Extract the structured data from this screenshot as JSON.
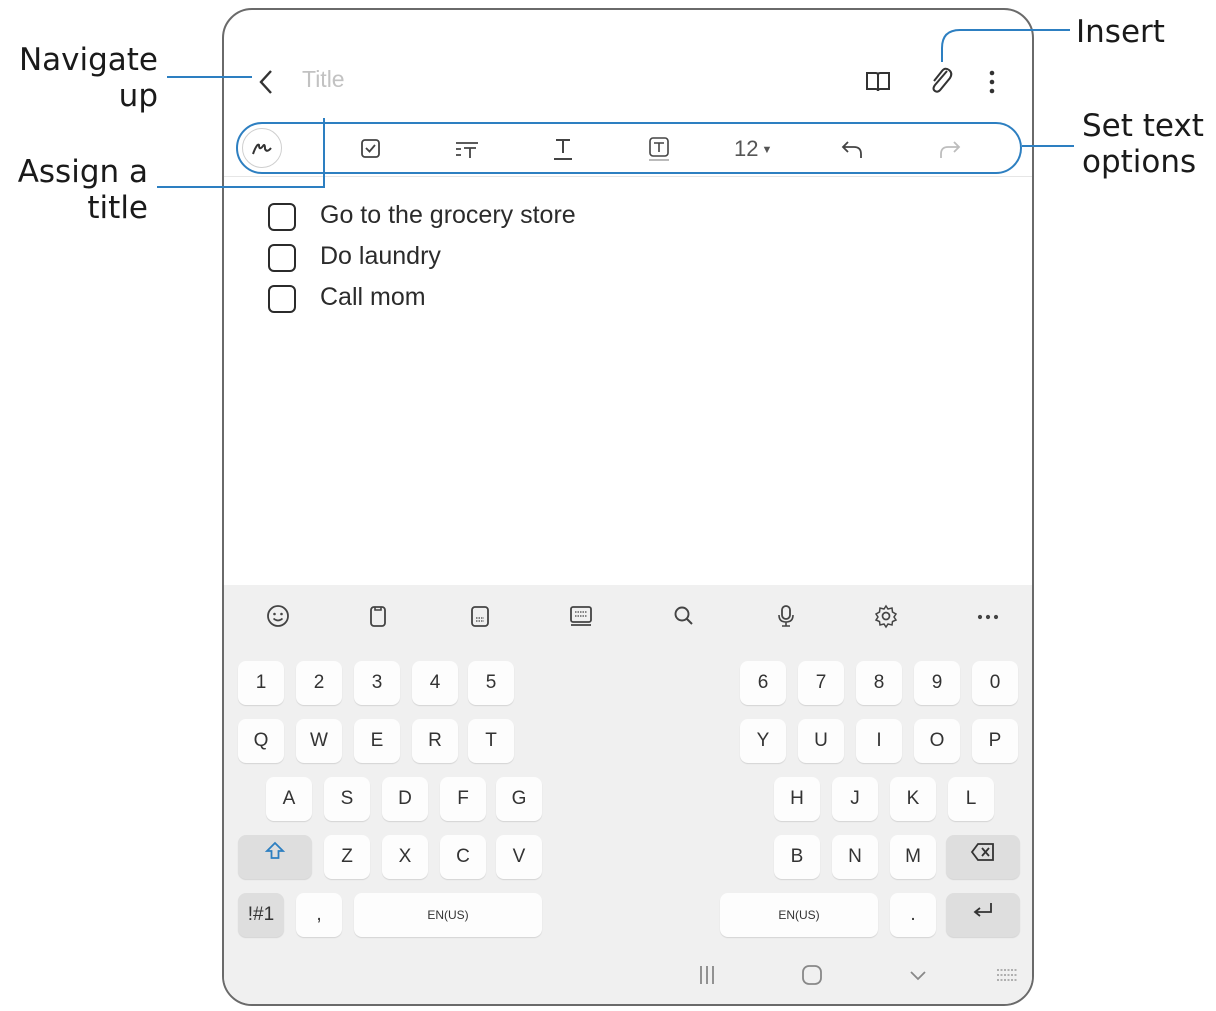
{
  "callouts": {
    "navigate_up": [
      "Navigate",
      "up"
    ],
    "assign_title": [
      "Assign a",
      "title"
    ],
    "insert": "Insert",
    "set_text_options": [
      "Set text",
      "options"
    ]
  },
  "appbar": {
    "back_icon": "chevron-left-icon",
    "title_placeholder": "Title",
    "actions": [
      "book-icon",
      "paperclip-icon",
      "more-vertical-icon"
    ]
  },
  "toolbar": {
    "tools": [
      "handwriting-icon",
      "checkbox-icon",
      "text-style-icon",
      "text-underline-icon",
      "text-highlight-icon"
    ],
    "font_size": "12",
    "undo": "undo-icon",
    "redo": "redo-icon"
  },
  "checklist": [
    {
      "text": "Go to the grocery store",
      "checked": false
    },
    {
      "text": "Do laundry",
      "checked": false
    },
    {
      "text": "Call mom",
      "checked": false
    }
  ],
  "keyboard": {
    "toolbar_icons": [
      "emoji-icon",
      "clipboard-icon",
      "keyboard-mode-icon",
      "keyboard-layout-icon",
      "search-icon",
      "microphone-icon",
      "settings-icon",
      "more-horizontal-icon"
    ],
    "left": {
      "numbers": [
        "1",
        "2",
        "3",
        "4",
        "5"
      ],
      "row1": [
        "Q",
        "W",
        "E",
        "R",
        "T"
      ],
      "row2": [
        "A",
        "S",
        "D",
        "F",
        "G"
      ],
      "row3": [
        "Z",
        "X",
        "C",
        "V"
      ],
      "symbols_key": "!#1",
      "comma_key": ",",
      "space_label": "EN(US)"
    },
    "right": {
      "numbers": [
        "6",
        "7",
        "8",
        "9",
        "0"
      ],
      "row1": [
        "Y",
        "U",
        "I",
        "O",
        "P"
      ],
      "row2": [
        "H",
        "J",
        "K",
        "L"
      ],
      "row3": [
        "B",
        "N",
        "M"
      ],
      "space_label": "EN(US)",
      "period_key": "."
    },
    "shift_icon": "shift-icon",
    "backspace_icon": "backspace-icon",
    "enter_icon": "enter-icon"
  },
  "navbar": [
    "recent-apps-icon",
    "home-icon",
    "hide-keyboard-icon",
    "keyboard-switch-icon"
  ],
  "colors": {
    "accent": "#2d7fc1",
    "callout_line": "#2d7fc1"
  }
}
